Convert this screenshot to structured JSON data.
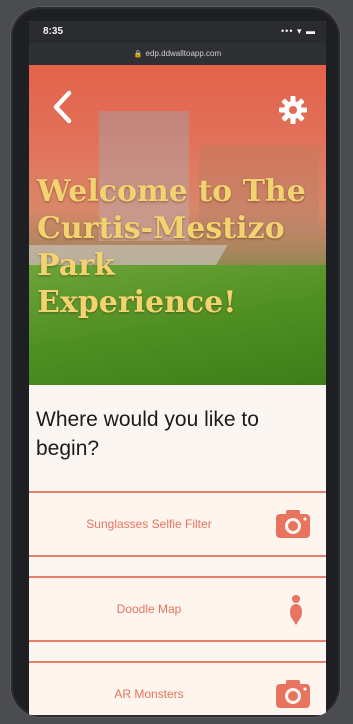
{
  "status_bar": {
    "time": "8:35",
    "icons": "••• ▾ ▬"
  },
  "browser": {
    "url": "edp.ddwalltoapp.com"
  },
  "header": {
    "title": "Welcome to The Curtis-Mestizo Park Experience!",
    "back_icon": "chevron-left-icon",
    "settings_icon": "gear-icon"
  },
  "main": {
    "prompt": "Where would you like to begin?",
    "options": [
      {
        "label": "Sunglasses Selfie Filter",
        "icon": "camera-icon"
      },
      {
        "label": "Doodle Map",
        "icon": "map-pin-icon"
      },
      {
        "label": "AR Monsters",
        "icon": "camera-icon"
      }
    ]
  },
  "colors": {
    "accent": "#e8735e",
    "title_gold": "#f2d36f",
    "hero_red": "#e4624a",
    "background": "#fbf6f1"
  }
}
